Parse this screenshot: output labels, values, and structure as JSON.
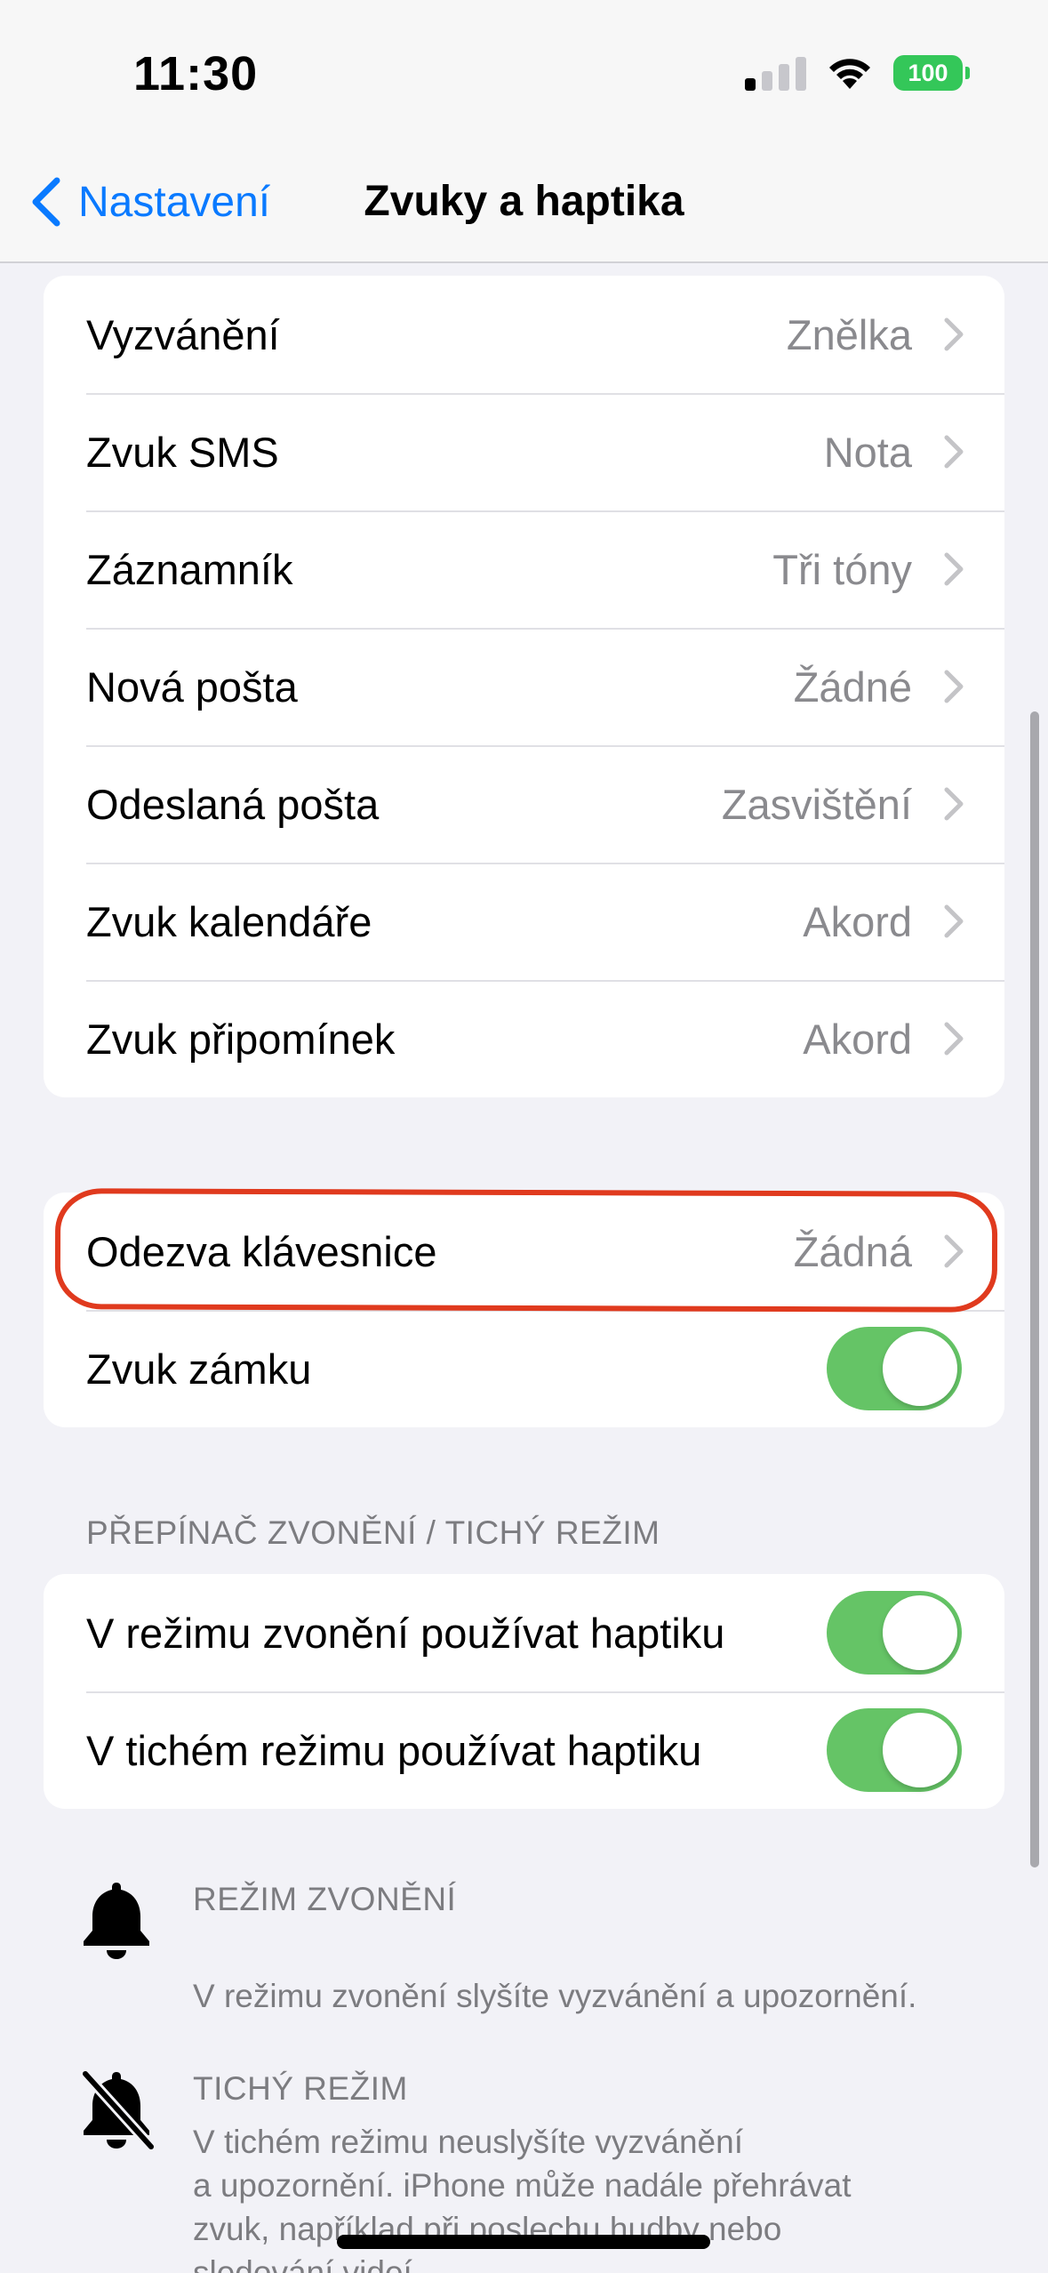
{
  "status": {
    "time": "11:30",
    "battery": "100"
  },
  "nav": {
    "back_label": "Nastavení",
    "title": "Zvuky a haptika"
  },
  "sounds": [
    {
      "label": "Vyzvánění",
      "value": "Znělka"
    },
    {
      "label": "Zvuk SMS",
      "value": "Nota"
    },
    {
      "label": "Záznamník",
      "value": "Tři tóny"
    },
    {
      "label": "Nová pošta",
      "value": "Žádné"
    },
    {
      "label": "Odeslaná pošta",
      "value": "Zasvištění"
    },
    {
      "label": "Zvuk kalendáře",
      "value": "Akord"
    },
    {
      "label": "Zvuk připomínek",
      "value": "Akord"
    }
  ],
  "system": {
    "keyboard": {
      "label": "Odezva klávesnice",
      "value": "Žádná"
    },
    "lock": {
      "label": "Zvuk zámku",
      "on": true
    }
  },
  "haptics": {
    "header": "PŘEPÍNAČ ZVONĚNÍ / TICHÝ REŽIM",
    "ring": {
      "label": "V režimu zvonění používat haptiku",
      "on": true
    },
    "silent": {
      "label": "V tichém režimu používat haptiku",
      "on": true
    }
  },
  "modes": {
    "ring_title": "REŽIM ZVONĚNÍ",
    "ring_desc": "V režimu zvonění slyšíte vyzvánění a upozornění.",
    "silent_title": "TICHÝ REŽIM",
    "silent_desc_1": "V tichém režimu neuslyšíte vyzvánění",
    "silent_desc_2": "a upozornění. iPhone může nadále přehrávat",
    "silent_desc_3": "zvuk, například při poslechu hudby nebo",
    "silent_desc_4": "sledování videí."
  },
  "colors": {
    "accent": "#0a7aff",
    "toggle_on": "#65c466",
    "highlight": "#e03a1e"
  }
}
